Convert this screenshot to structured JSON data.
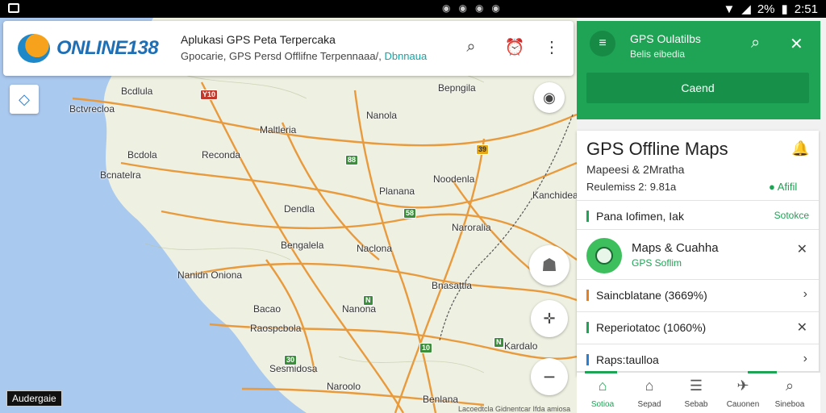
{
  "status_bar": {
    "battery": "2%",
    "time": "2:51"
  },
  "header": {
    "logo_text": "ONLINE138",
    "title": "Aplukasi GPS Peta Terpercaka",
    "subtitle_main": "Gpocarie, GPS Persd Offlifne Terpennaaa/,",
    "subtitle_accent": "Dbnnaua"
  },
  "map": {
    "places": [
      {
        "label": "Bcdlula"
      },
      {
        "label": "Bepngila"
      },
      {
        "label": "Bctvrecloa"
      },
      {
        "label": "Nanola"
      },
      {
        "label": "Maltleria"
      },
      {
        "label": "Bcdola"
      },
      {
        "label": "Reconda"
      },
      {
        "label": "Bcnatelra"
      },
      {
        "label": "Planana"
      },
      {
        "label": "Noodenla"
      },
      {
        "label": "Kanchidea"
      },
      {
        "label": "Dendla"
      },
      {
        "label": "Naroralia"
      },
      {
        "label": "Bengalela"
      },
      {
        "label": "Naclona"
      },
      {
        "label": "Nanidn Oniona"
      },
      {
        "label": "Bnasattla"
      },
      {
        "label": "Bacao"
      },
      {
        "label": "Nanona"
      },
      {
        "label": "Raospcbola"
      },
      {
        "label": "Kardalo"
      },
      {
        "label": "Sesmidosa"
      },
      {
        "label": "Naroolo"
      },
      {
        "label": "Benlana"
      }
    ],
    "shields": [
      {
        "label": "Y10"
      },
      {
        "label": "88"
      },
      {
        "label": "39"
      },
      {
        "label": "58"
      },
      {
        "label": "N"
      },
      {
        "label": "10"
      },
      {
        "label": "30"
      },
      {
        "label": "N"
      }
    ],
    "footer_badge": "Audergaie",
    "attribution": "Lacoedtcla Gidnentcar Ifda amiosa"
  },
  "panel": {
    "head_title": "GPS Oulatilbs",
    "head_sub": "Belis eibedia",
    "head_button": "Caend",
    "card": {
      "title": "GPS Offline Maps",
      "line1": "Mapeesi &  2Mratha",
      "line2": "Reulemiss  2:  9.81a",
      "status": "Afifil",
      "row_label": "Pana Iofimen, Iak",
      "row_value": "Sotokce"
    },
    "app": {
      "name": "Maps & Cuahha",
      "sub": "GPS Soflim"
    },
    "items": [
      {
        "label": "Saincblatane (3669%)",
        "color": "#e67e22"
      },
      {
        "label": "Reperiotatoc (1060%)",
        "color": "#1fa355"
      },
      {
        "label": "Raps:taulloa",
        "color": "#2a7fd4"
      }
    ],
    "nav": [
      {
        "label": "Sotioa",
        "icon": "home-icon"
      },
      {
        "label": "Sepad",
        "icon": "bookmark-icon"
      },
      {
        "label": "Sebab",
        "icon": "list-icon"
      },
      {
        "label": "Cauonen",
        "icon": "directions-icon"
      },
      {
        "label": "Sineboa",
        "icon": "search-icon"
      }
    ]
  },
  "colors": {
    "accent_green": "#1fa355",
    "water": "#aac9ef",
    "road": "#e89a3c"
  }
}
